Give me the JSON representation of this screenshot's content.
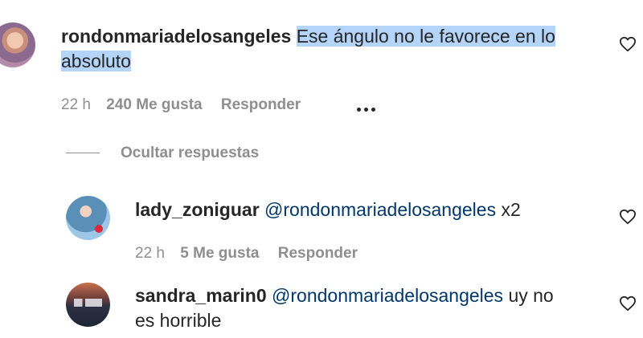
{
  "comment": {
    "username": "rondonmariadelosangeles",
    "text_line1": "Ese ángulo no le favorece en lo",
    "text_line2": "absoluto",
    "time": "22 h",
    "likes": "240 Me gusta",
    "reply": "Responder"
  },
  "replies_toggle": {
    "label": "Ocultar respuestas"
  },
  "replies": [
    {
      "username": "lady_zoniguar",
      "mention": "@rondonmariadelosangeles",
      "text": "x2",
      "time": "22 h",
      "likes": "5 Me gusta",
      "reply": "Responder"
    },
    {
      "username": "sandra_marin0",
      "mention": "@rondonmariadelosangeles",
      "text_line1": "uy no",
      "text_line2": "es horrible"
    }
  ],
  "icons": {
    "like": "heart-outline-icon",
    "more": "more-options-icon"
  },
  "colors": {
    "text": "#262626",
    "secondary": "#8e8e8e",
    "mention": "#00376b",
    "selection": "#b4d4f9"
  }
}
